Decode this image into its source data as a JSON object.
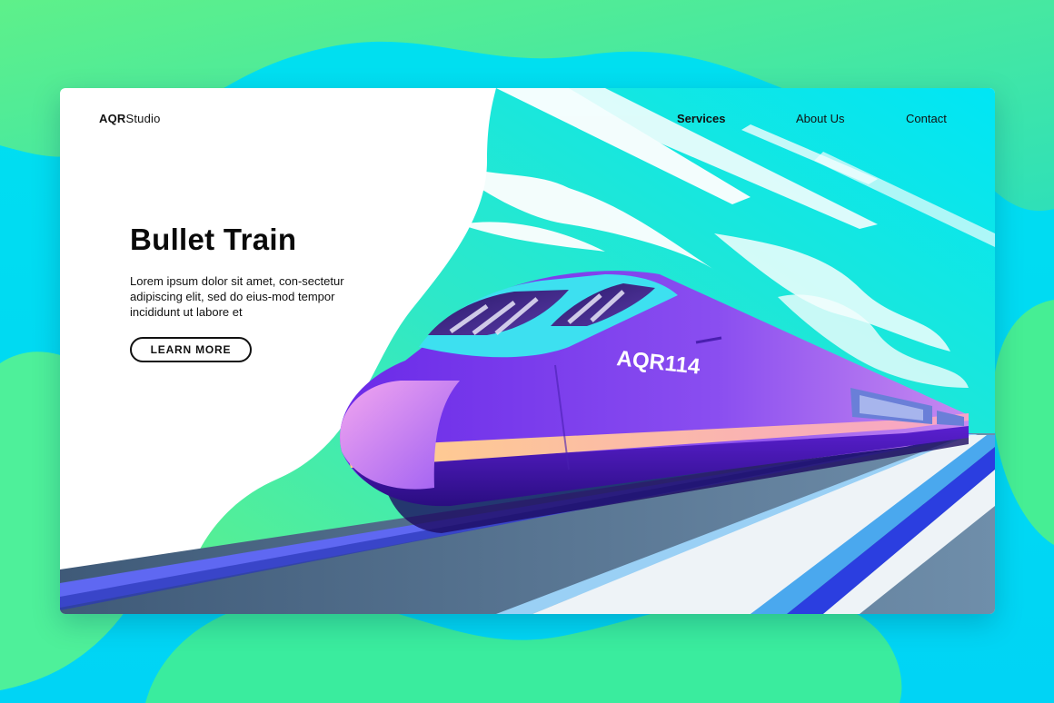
{
  "brand": {
    "bold": "AQR",
    "rest": "Studio"
  },
  "nav": {
    "services": "Services",
    "about": "About Us",
    "contact": "Contact"
  },
  "hero": {
    "title": "Bullet Train",
    "text": "Lorem ipsum dolor sit amet, con-sectetur adipiscing elit, sed do eius-mod tempor incididunt ut labore et",
    "cta": "LEARN MORE"
  },
  "train": {
    "number": "AQR114"
  },
  "icons": [
    "bullet-train-illustration"
  ]
}
